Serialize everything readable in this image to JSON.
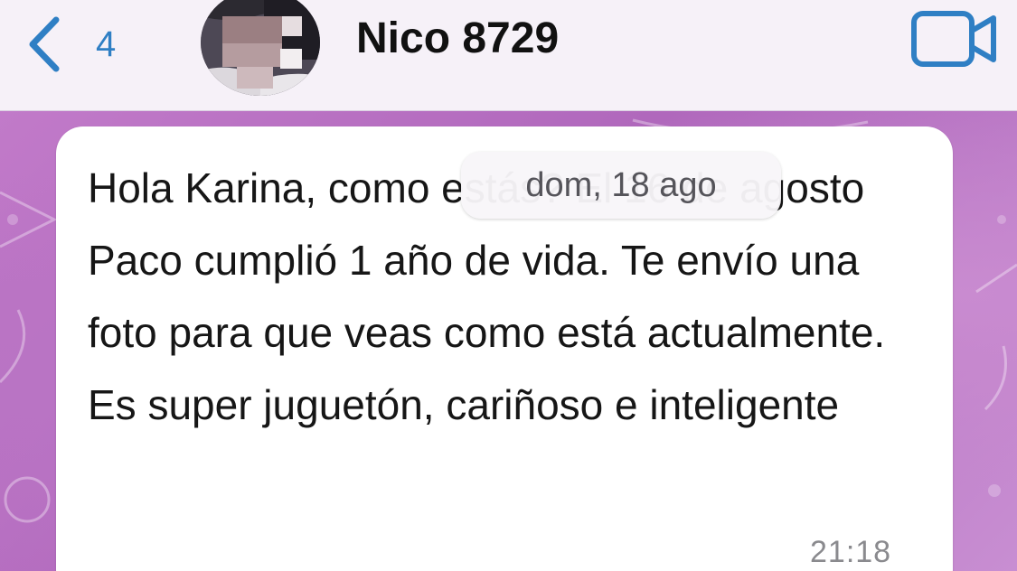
{
  "header": {
    "back_count": "4",
    "contact_name": "Nico 8729",
    "icons": {
      "back": "chevron-left-icon",
      "video": "video-camera-icon"
    },
    "accent_color": "#2f7fc4"
  },
  "chat": {
    "date_separator": "dom, 18 ago",
    "message": {
      "text": "Hola Karina, como estás? El 16 de agosto Paco cumplió 1 año de vida. Te envío una foto para que veas como está actualmente. Es super juguetón, cariñoso e inteligente",
      "time": "21:18"
    },
    "background_color": "#c17ac9"
  }
}
